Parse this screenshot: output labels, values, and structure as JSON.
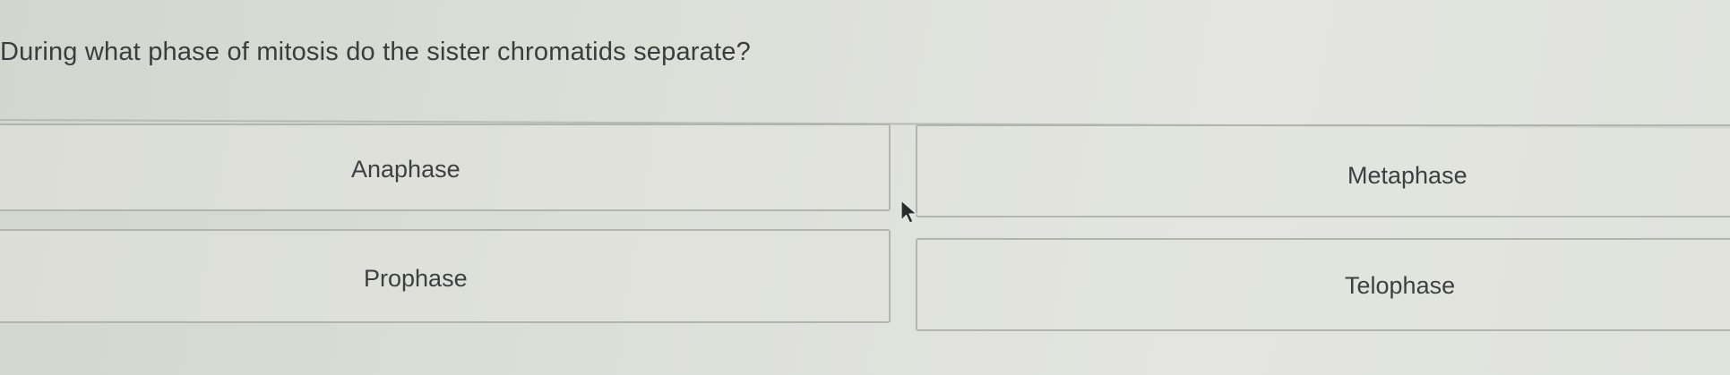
{
  "question": {
    "text": "During what phase of mitosis do the sister chromatids separate?"
  },
  "options": [
    {
      "label": "Anaphase"
    },
    {
      "label": "Metaphase"
    },
    {
      "label": "Prophase"
    },
    {
      "label": "Telophase"
    }
  ],
  "icons": {
    "cursor": "mouse-pointer-icon"
  },
  "colors": {
    "background": "#dcded8",
    "border": "#b2b4ae",
    "text": "#3c3c3e"
  }
}
